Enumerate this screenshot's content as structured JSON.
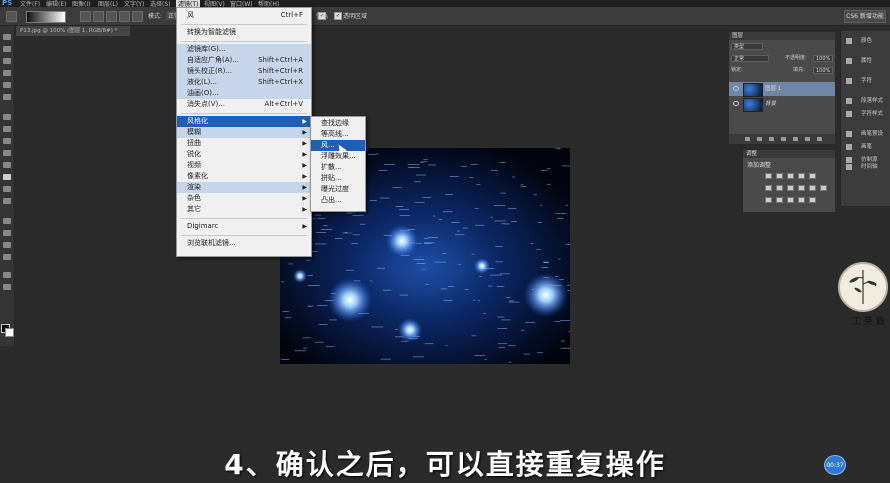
{
  "menubar": {
    "app": "PS",
    "items": [
      "文件(F)",
      "编辑(E)",
      "图像(I)",
      "图层(L)",
      "文字(Y)",
      "选择(S)",
      "滤镜(T)",
      "视图(V)",
      "窗口(W)",
      "帮助(H)"
    ]
  },
  "options": {
    "mode_label": "模式:",
    "mode_value": "正常",
    "reverse_label": "反向",
    "dither_label": "仿色",
    "transparency_label": "透明区域",
    "workspace": "CS6 新增功能"
  },
  "document": {
    "tab": "P13.jpg @ 100% (图层 1, RGB/8#) *"
  },
  "filter_menu": {
    "last_filter": {
      "label": "风",
      "shortcut": "Ctrl+F"
    },
    "convert": "转换为智能滤镜",
    "gallery": "滤镜库(G)...",
    "adaptive": {
      "label": "自适应广角(A)...",
      "shortcut": "Shift+Ctrl+A"
    },
    "lens": {
      "label": "镜头校正(R)...",
      "shortcut": "Shift+Ctrl+R"
    },
    "liquify": {
      "label": "液化(L)...",
      "shortcut": "Shift+Ctrl+X"
    },
    "oilpaint": "油画(O)...",
    "vanish": {
      "label": "消失点(V)...",
      "shortcut": "Alt+Ctrl+V"
    },
    "stylize": "风格化",
    "blur": "模糊",
    "distort": "扭曲",
    "sharpen": "锐化",
    "video": "视频",
    "pixelate": "像素化",
    "render": "渲染",
    "noise": "杂色",
    "other": "其它",
    "digimarc": "Digimarc",
    "browse": "浏览联机滤镜..."
  },
  "submenu": {
    "items": [
      "查找边缘",
      "等高线...",
      "风...",
      "浮雕效果...",
      "扩散...",
      "拼贴...",
      "曝光过度",
      "凸出..."
    ]
  },
  "layers": {
    "tab": "图层",
    "kind": "类型",
    "blend": "正常",
    "opacity_label": "不透明度:",
    "opacity": "100%",
    "lock_label": "锁定:",
    "fill_label": "填充:",
    "fill": "100%",
    "list": [
      {
        "name": "图层 1",
        "active": true
      },
      {
        "name": "背景",
        "active": false
      }
    ]
  },
  "adjustments": {
    "tab": "调整",
    "title": "添加调整"
  },
  "dock": {
    "items": [
      "颜色",
      "属性",
      "字符",
      "段落样式",
      "字符样式",
      "画笔预设",
      "画笔",
      "仿制源",
      "时间轴"
    ]
  },
  "logo": {
    "text": "工 英 篇"
  },
  "subtitle": "4、确认之后，可以直接重复操作",
  "badge": "00:37",
  "colors": {
    "menu_highlight": "#1f5fb4",
    "menu_hover": "#c7d5ea",
    "accent": "#3d9be9"
  }
}
